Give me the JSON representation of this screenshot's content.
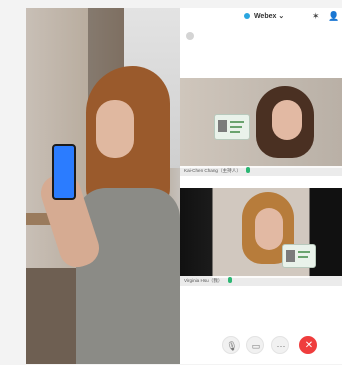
{
  "app": {
    "name": "Webex"
  },
  "participants": [
    {
      "name": "Kai-Chen Chang（主持人）"
    },
    {
      "name": "Virginia Hsu（我）"
    }
  ],
  "controls": {
    "mic": "microphone-icon",
    "video": "video-camera-icon",
    "more": "more-icon",
    "leave": "leave-call-icon"
  },
  "colors": {
    "leave_red": "#ef3d3d",
    "webex_blue": "#2aa6e0",
    "mic_green": "#2bb673"
  }
}
